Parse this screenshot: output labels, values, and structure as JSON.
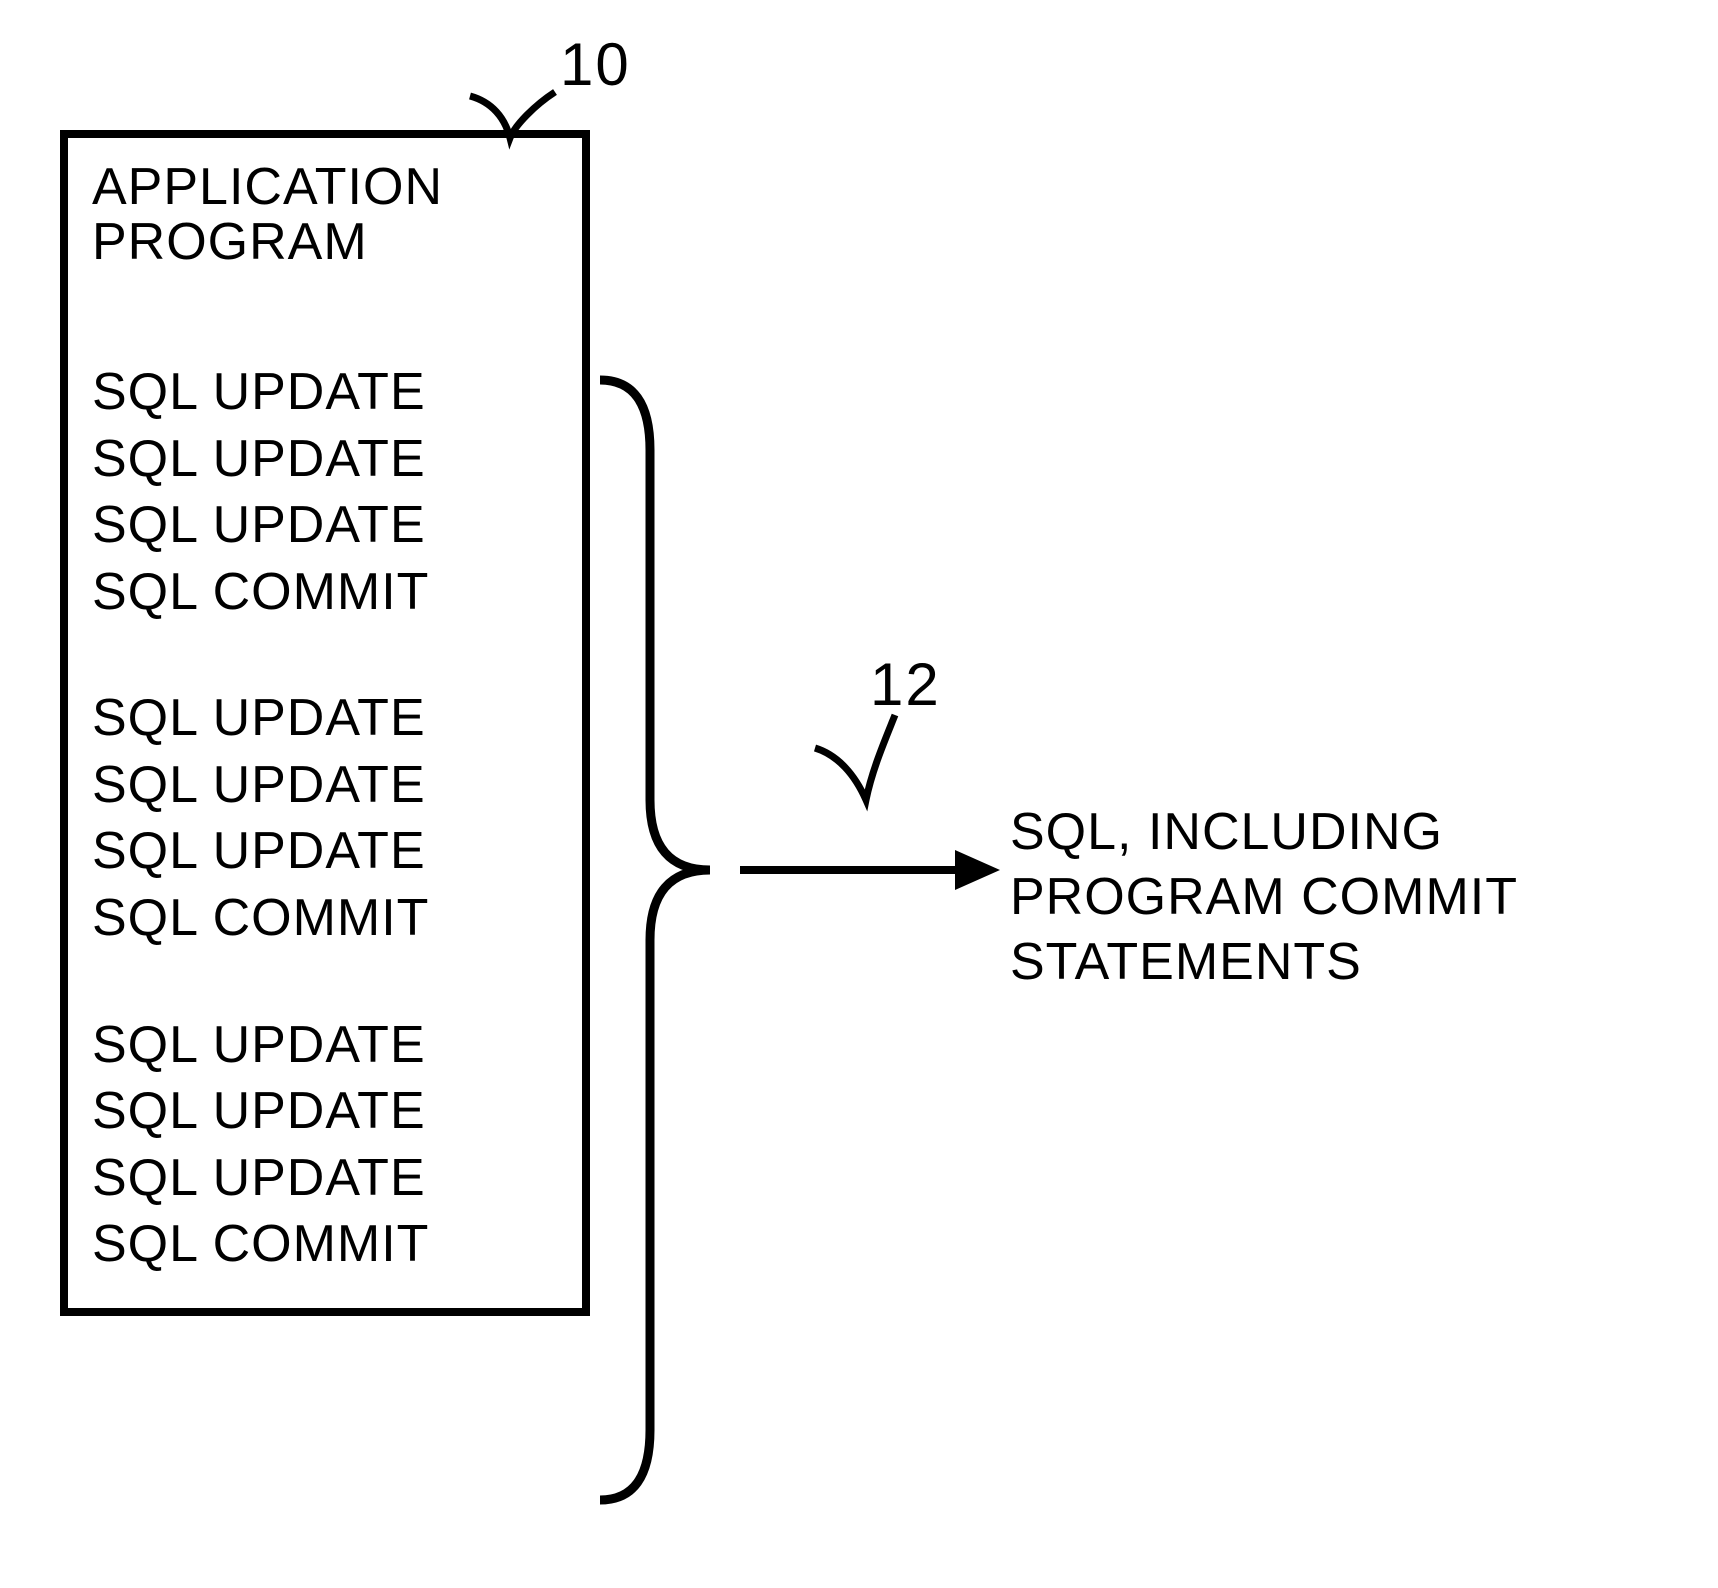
{
  "refs": {
    "box": "10",
    "arrow": "12"
  },
  "box": {
    "title": "APPLICATION\nPROGRAM",
    "blocks": [
      {
        "lines": [
          "SQL  UPDATE",
          "SQL  UPDATE",
          "SQL  UPDATE",
          "SQL  COMMIT"
        ]
      },
      {
        "lines": [
          "SQL  UPDATE",
          "SQL  UPDATE",
          "SQL  UPDATE",
          "SQL  COMMIT"
        ]
      },
      {
        "lines": [
          "SQL  UPDATE",
          "SQL  UPDATE",
          "SQL  UPDATE",
          "SQL  COMMIT"
        ]
      }
    ]
  },
  "output": "SQL,  INCLUDING\nPROGRAM COMMIT STATEMENTS"
}
